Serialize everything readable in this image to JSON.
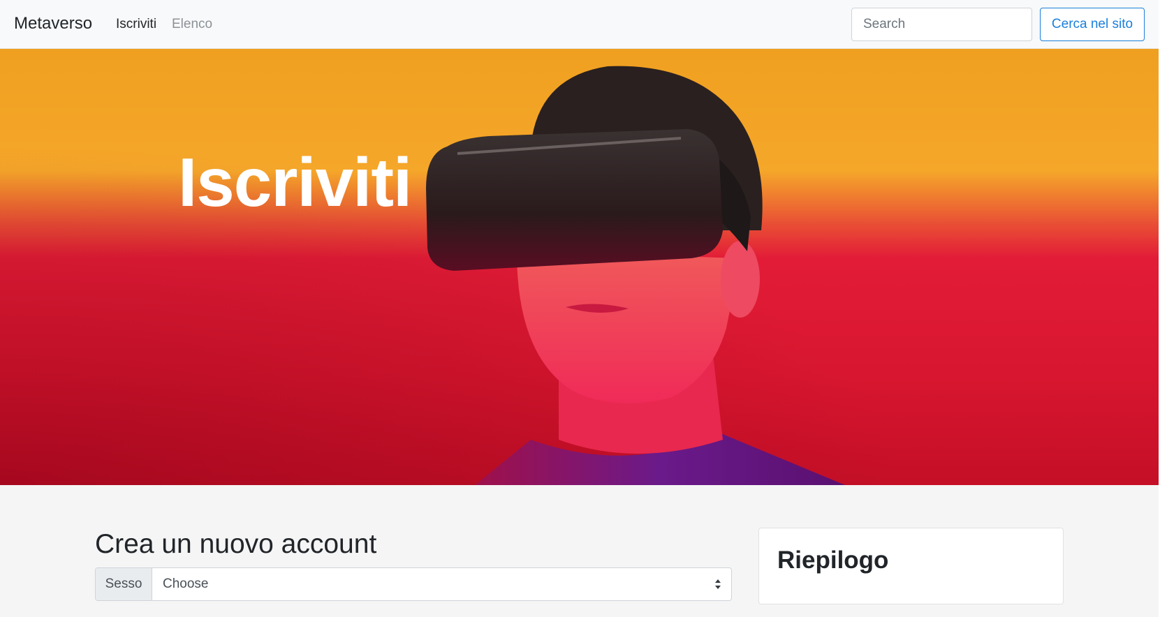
{
  "navbar": {
    "brand": "Metaverso",
    "links": [
      {
        "label": "Iscriviti",
        "active": true
      },
      {
        "label": "Elenco",
        "active": false
      }
    ],
    "search": {
      "placeholder": "Search",
      "value": ""
    },
    "search_button": "Cerca nel sito",
    "accent": "#1a7fdb"
  },
  "hero": {
    "title": "Iscriviti",
    "image": "vr-headset-person"
  },
  "main": {
    "title": "Crea un nuovo account",
    "gender": {
      "label": "Sesso",
      "selected": "Choose"
    }
  },
  "summary": {
    "title": "Riepilogo"
  }
}
